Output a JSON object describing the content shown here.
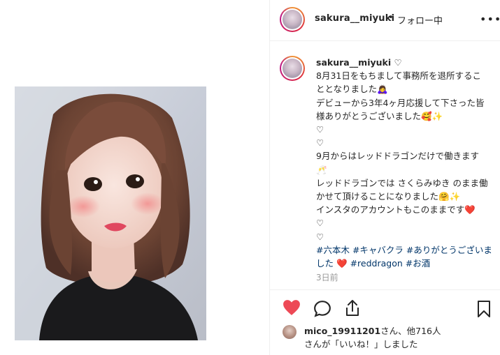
{
  "header": {
    "username": "sakura__miyuki",
    "separator": "•",
    "follow_status": "フォロー中",
    "more_label": "•••"
  },
  "caption": {
    "username": "sakura__miyuki ♡",
    "lines": [
      "8月31日をもちまして事務所を退所するこ",
      "ととなりました🙇‍♀️",
      "デビューから3年4ヶ月応援して下さった皆",
      "様ありがとうございました🥰✨",
      "♡",
      "♡",
      "9月からはレッドドラゴンだけで働きます",
      "🥂",
      "レッドドラゴンでは さくらみゆき のまま働",
      "かせて頂けることになりました🤗✨",
      "インスタのアカウントもこのままです❤️",
      "♡",
      "♡"
    ],
    "tags_line1": "#六本木 #キャバクラ #ありがとうございま",
    "tags_line2_pre": "した",
    "tags_heart": "❤️",
    "tags_line2_post": "#reddragon #お酒",
    "time": "3日前"
  },
  "likes": {
    "user": "mico_19911201",
    "text1": "さん、他716人",
    "text2": "さんが「いいね！」しました"
  },
  "colors": {
    "like_red": "#ed4956",
    "link_blue": "#003569",
    "muted_gray": "#999999"
  },
  "icons": [
    "heart-icon",
    "comment-icon",
    "share-icon",
    "bookmark-icon",
    "more-icon"
  ]
}
